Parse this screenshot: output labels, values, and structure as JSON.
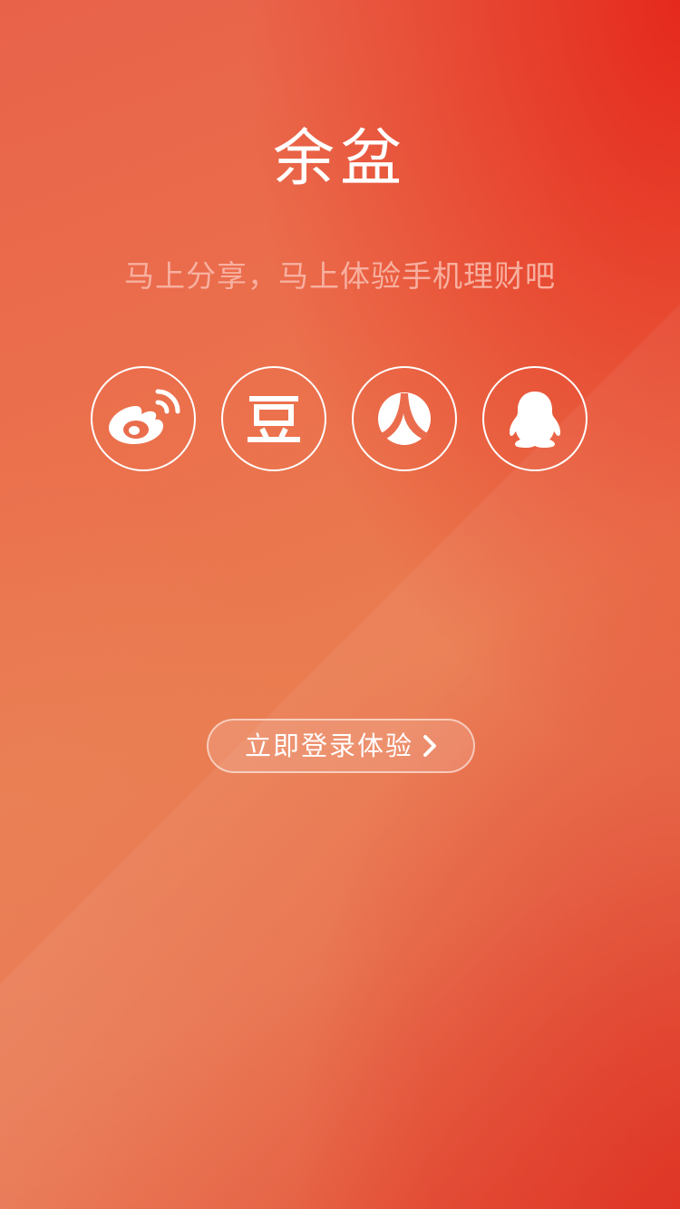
{
  "header": {
    "title": "余盆",
    "subtitle": "马上分享，马上体验手机理财吧"
  },
  "share": {
    "items": [
      {
        "icon": "weibo-icon"
      },
      {
        "icon": "douban-icon",
        "glyph": "豆"
      },
      {
        "icon": "renren-icon"
      },
      {
        "icon": "qq-icon"
      }
    ]
  },
  "login": {
    "label": "立即登录体验",
    "icon": "chevron-right-icon"
  },
  "colors": {
    "background_top": "#e8624a",
    "background_accent": "#e41e14",
    "subtitle": "#f8b0a0",
    "icon_stroke": "#ffffff"
  }
}
